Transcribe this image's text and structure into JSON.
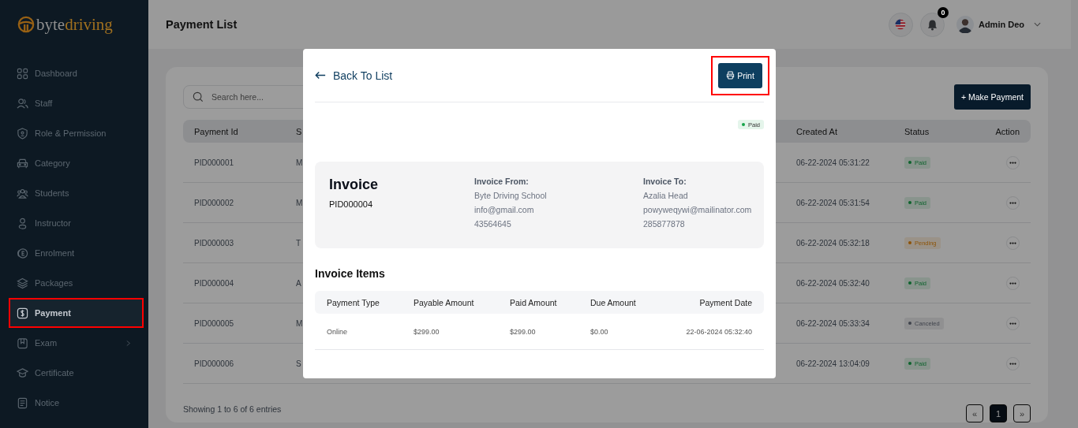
{
  "logo": {
    "prefix": "byte",
    "suffix": "driving"
  },
  "sidebar": {
    "items": [
      {
        "label": "Dashboard",
        "selected": false,
        "highlighted": false,
        "has_submenu": false
      },
      {
        "label": "Staff",
        "selected": false,
        "highlighted": false,
        "has_submenu": false
      },
      {
        "label": "Role & Permission",
        "selected": false,
        "highlighted": false,
        "has_submenu": false
      },
      {
        "label": "Category",
        "selected": false,
        "highlighted": false,
        "has_submenu": false
      },
      {
        "label": "Students",
        "selected": false,
        "highlighted": false,
        "has_submenu": false
      },
      {
        "label": "Instructor",
        "selected": false,
        "highlighted": false,
        "has_submenu": false
      },
      {
        "label": "Enrolment",
        "selected": false,
        "highlighted": false,
        "has_submenu": false
      },
      {
        "label": "Packages",
        "selected": false,
        "highlighted": false,
        "has_submenu": false
      },
      {
        "label": "Payment",
        "selected": true,
        "highlighted": true,
        "has_submenu": false
      },
      {
        "label": "Exam",
        "selected": false,
        "highlighted": false,
        "has_submenu": true
      },
      {
        "label": "Certificate",
        "selected": false,
        "highlighted": false,
        "has_submenu": false
      },
      {
        "label": "Notice",
        "selected": false,
        "highlighted": false,
        "has_submenu": false
      }
    ]
  },
  "header": {
    "title": "Payment List",
    "notification_count": "0",
    "user_name": "Admin Deo"
  },
  "search": {
    "placeholder": "Search here..."
  },
  "make_payment_button": "+ Make Payment",
  "table": {
    "columns": [
      "Payment Id",
      "S",
      "Created At",
      "Status",
      "Action"
    ],
    "rows": [
      {
        "payment_id": "PID000001",
        "column_2": "M",
        "created_at": "06-22-2024 05:31:22",
        "status": "Paid",
        "color": "#0d622c"
      },
      {
        "payment_id": "PID000002",
        "column_2": "M",
        "created_at": "06-22-2024 05:31:54",
        "status": "Paid",
        "color": "#0d622c"
      },
      {
        "payment_id": "PID000003",
        "column_2": "T",
        "created_at": "06-22-2024 05:32:18",
        "status": "Pending",
        "color": "#8c5307"
      },
      {
        "payment_id": "PID000004",
        "column_2": "A",
        "created_at": "06-22-2024 05:32:40",
        "status": "Paid",
        "color": "#0d622c"
      },
      {
        "payment_id": "PID000005",
        "column_2": "M",
        "created_at": "06-22-2024 05:33:34",
        "status": "Canceled",
        "color": "#40444d"
      },
      {
        "payment_id": "PID000006",
        "column_2": "S",
        "created_at": "06-22-2024 13:04:09",
        "status": "Paid",
        "color": "#0d622c"
      }
    ]
  },
  "entries_info": "Showing 1 to 6 of 6 entries",
  "pagination": [
    {
      "label": "«",
      "selected": false
    },
    {
      "label": "1",
      "selected": true
    },
    {
      "label": "»",
      "selected": false
    }
  ],
  "modal": {
    "back_link": "Back To List",
    "print_button": {
      "label": "Print",
      "highlighted": true
    },
    "status": {
      "label": "Paid",
      "color": "#16a34a"
    },
    "invoice": {
      "title": "Invoice",
      "id": "PID000004",
      "from": {
        "heading": "Invoice From:",
        "lines": [
          "Byte Driving School",
          "info@gmail.com",
          "43564645"
        ]
      },
      "to": {
        "heading": "Invoice To:",
        "lines": [
          "Azalia Head",
          "powyweqywi@mailinator.com",
          "285877878"
        ]
      }
    },
    "items_title": "Invoice Items",
    "items_columns": [
      "Payment Type",
      "Payable Amount",
      "Paid Amount",
      "Due Amount",
      "Payment Date"
    ],
    "items_rows": [
      [
        "Online",
        "$299.00",
        "$299.00",
        "$0.00",
        "22-06-2024 05:32:40"
      ]
    ]
  }
}
